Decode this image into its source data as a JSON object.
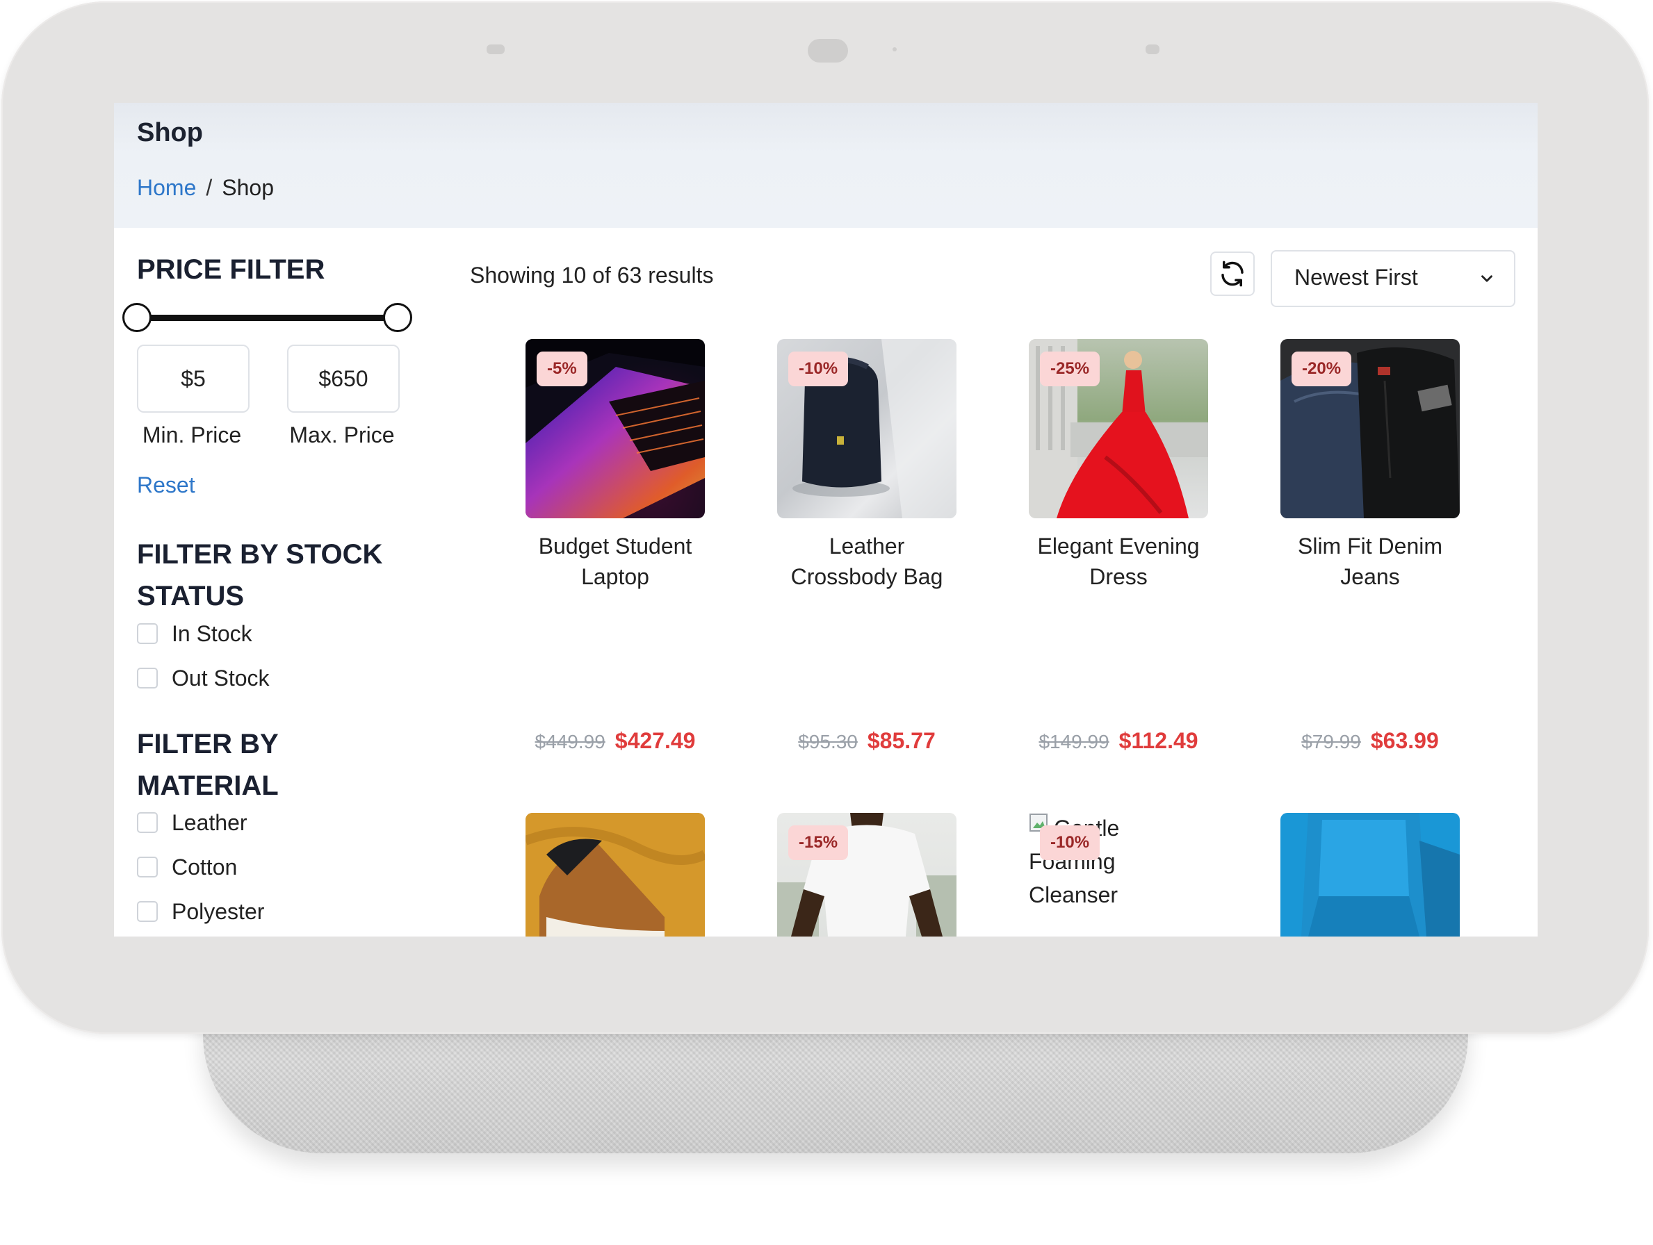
{
  "header": {
    "title": "Shop",
    "breadcrumb": {
      "home": "Home",
      "separator": "/",
      "current": "Shop"
    }
  },
  "sidebar": {
    "price_filter": {
      "title": "PRICE FILTER",
      "min_value": "$5",
      "max_value": "$650",
      "min_label": "Min. Price",
      "max_label": "Max. Price",
      "reset_label": "Reset"
    },
    "stock_filter": {
      "title_line1": "FILTER BY STOCK",
      "title_line2": "STATUS",
      "options": [
        "In Stock",
        "Out Stock"
      ]
    },
    "material_filter": {
      "title_line1": "FILTER BY",
      "title_line2": "MATERIAL",
      "options": [
        "Leather",
        "Cotton",
        "Polyester"
      ]
    }
  },
  "main": {
    "results_text": "Showing 10 of 63 results",
    "refresh_icon": "refresh-icon",
    "sort": {
      "selected": "Newest First",
      "icon": "chevron-down-icon"
    },
    "products": [
      {
        "badge": "-5%",
        "name_line1": "Budget Student",
        "name_line2": "Laptop",
        "old_price": "$449.99",
        "new_price": "$427.49"
      },
      {
        "badge": "-10%",
        "name_line1": "Leather",
        "name_line2": "Crossbody Bag",
        "old_price": "$95.30",
        "new_price": "$85.77"
      },
      {
        "badge": "-25%",
        "name_line1": "Elegant Evening",
        "name_line2": "Dress",
        "old_price": "$149.99",
        "new_price": "$112.49"
      },
      {
        "badge": "-20%",
        "name_line1": "Slim Fit Denim",
        "name_line2": "Jeans",
        "old_price": "$79.99",
        "new_price": "$63.99"
      },
      {
        "badge": ""
      },
      {
        "badge": "-15%"
      },
      {
        "badge": "-10%",
        "broken_alt_line1": "Gentle",
        "broken_alt_line2": "Foaming",
        "broken_alt_line3": "Cleanser"
      },
      {
        "badge": ""
      }
    ]
  },
  "colors": {
    "accent_link": "#2e77c9",
    "sale_price": "#e03c3c",
    "badge_bg": "#fbd6d6",
    "badge_text": "#9a2727"
  }
}
